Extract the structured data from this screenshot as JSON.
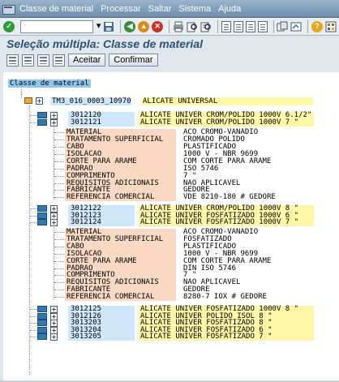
{
  "menu": {
    "items": [
      "Classe de material",
      "Processar",
      "Saltar",
      "Sistema",
      "Ajuda"
    ]
  },
  "toolbar": {
    "command_value": "",
    "icons": [
      "check-icon",
      "back-icon",
      "exit-icon",
      "cancel-icon",
      "print-icon",
      "find-icon",
      "find-next-icon",
      "first-page-icon",
      "prev-page-icon",
      "next-page-icon",
      "last-page-icon",
      "new-session-icon",
      "shortcut-icon",
      "help-icon",
      "layout-icon"
    ]
  },
  "title": "Seleção múltipla: Classe de material",
  "app_toolbar": {
    "accept_label": "Aceitar",
    "confirm_label": "Confirmar"
  },
  "tree": {
    "root_label": "Classe de material",
    "root_node": {
      "code": "TM3_016_0003_10970",
      "description": "ALICATE UNIVERSAL"
    },
    "group1": [
      {
        "code": "3012120",
        "description": "ALICATE UNIVER CROM/POLIDO 1000V 6.1/2\""
      },
      {
        "code": "3012121",
        "description": "ALICATE UNIVER CROM/POLIDO 1000V 7 \""
      }
    ],
    "chars1": [
      {
        "name": "MATERIAL",
        "value": "ACO CROMO-VANADIO"
      },
      {
        "name": "TRATAMENTO SUPERFICIAL",
        "value": "CROMADO POLIDO"
      },
      {
        "name": "CABO",
        "value": "PLASTIFICADO"
      },
      {
        "name": "ISOLACAO",
        "value": "1000 V - NBR 9699"
      },
      {
        "name": "CORTE PARA ARAME",
        "value": "COM CORTE PARA ARAME"
      },
      {
        "name": "PADRAO",
        "value": "ISO 5746"
      },
      {
        "name": "COMPRIMENTO",
        "value": "7 \""
      },
      {
        "name": "REQUISITOS ADICIONAIS",
        "value": "NAO APLICAVEL"
      },
      {
        "name": "FABRICANTE",
        "value": "GEDORE"
      },
      {
        "name": "REFERENCIA COMERCIAL",
        "value": "VDE 8210-180 # GEDORE"
      }
    ],
    "group2": [
      {
        "code": "3012122",
        "description": "ALICATE UNIVER CROM/POLIDO 1000V 8 \""
      },
      {
        "code": "3012123",
        "description": "ALICATE UNIVER FOSFATIZADO 1000V 6 \""
      },
      {
        "code": "3012124",
        "description": "ALICATE UNIVER FOSFATIZADO 1000V 7 \""
      }
    ],
    "chars2": [
      {
        "name": "MATERIAL",
        "value": "ACO CROMO-VANADIO"
      },
      {
        "name": "TRATAMENTO SUPERFICIAL",
        "value": "FOSFATIZADO"
      },
      {
        "name": "CABO",
        "value": "PLASTIFICADO"
      },
      {
        "name": "ISOLACAO",
        "value": "1000 V - NBR 9699"
      },
      {
        "name": "CORTE PARA ARAME",
        "value": "COM CORTE PARA ARAME"
      },
      {
        "name": "PADRAO",
        "value": "DIN ISO 5746"
      },
      {
        "name": "COMPRIMENTO",
        "value": "7 \""
      },
      {
        "name": "REQUISITOS ADICIONAIS",
        "value": "NAO APLICAVEL"
      },
      {
        "name": "FABRICANTE",
        "value": "GEDORE"
      },
      {
        "name": "REFERENCIA COMERCIAL",
        "value": "8280-7 IOX # GEDORE"
      }
    ],
    "group3": [
      {
        "code": "3012125",
        "description": "ALICATE UNIVER FOSFATIZADO 1000V 8 \""
      },
      {
        "code": "3012126",
        "description": "ALICATE UNIVER POLIDO ISOL 8 \""
      },
      {
        "code": "3013203",
        "description": "ALICATE UNIVER FOSFATIZADO 8 \""
      },
      {
        "code": "3013204",
        "description": "ALICATE UNIVER FOSFATIZADO 6 \""
      },
      {
        "code": "3013205",
        "description": "ALICATE UNIVER FOSFATIZADO 7 \""
      }
    ]
  },
  "colors": {
    "menubar": "#7e9bb8",
    "title": "#2d5273",
    "code_bg": "#cfe7fb",
    "desc_bg": "#fff7a8",
    "char_bg": "#f9d9c3",
    "root_label_bg": "#8fc6ee"
  }
}
